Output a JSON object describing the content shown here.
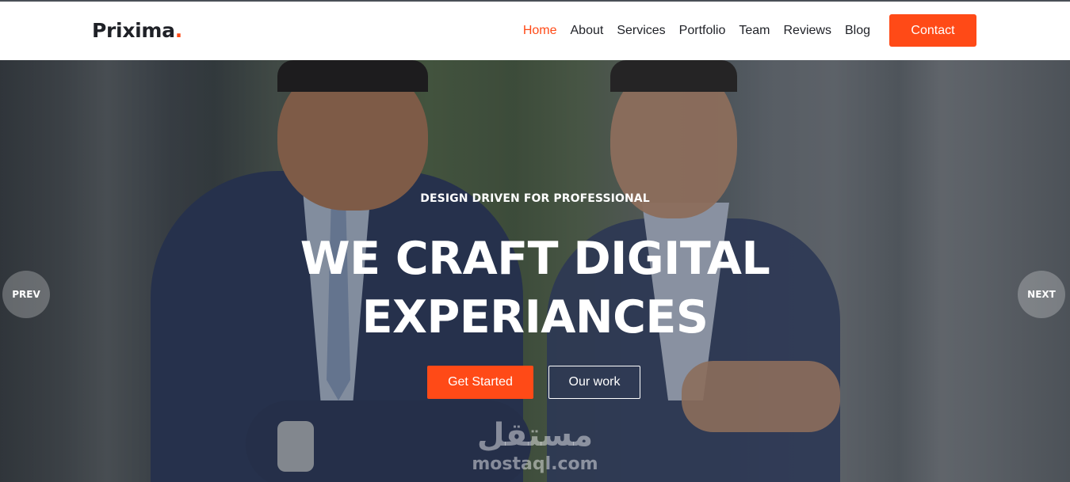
{
  "header": {
    "logo_text": "Prixima",
    "logo_dot": ".",
    "nav": [
      {
        "label": "Home",
        "active": true
      },
      {
        "label": "About"
      },
      {
        "label": "Services"
      },
      {
        "label": "Portfolio"
      },
      {
        "label": "Team"
      },
      {
        "label": "Reviews"
      },
      {
        "label": "Blog"
      }
    ],
    "contact_label": "Contact"
  },
  "hero": {
    "subtitle": "DESIGN DRIVEN FOR PROFESSIONAL",
    "title_line1": "WE CRAFT DIGITAL",
    "title_line2": "EXPERIANCES",
    "primary_button": "Get Started",
    "secondary_button": "Our work",
    "prev_label": "PREV",
    "next_label": "NEXT"
  },
  "watermark": {
    "arabic": "مستقل",
    "latin": "mostaql.com"
  },
  "colors": {
    "accent": "#ff4a17",
    "text_dark": "#1f2127"
  }
}
